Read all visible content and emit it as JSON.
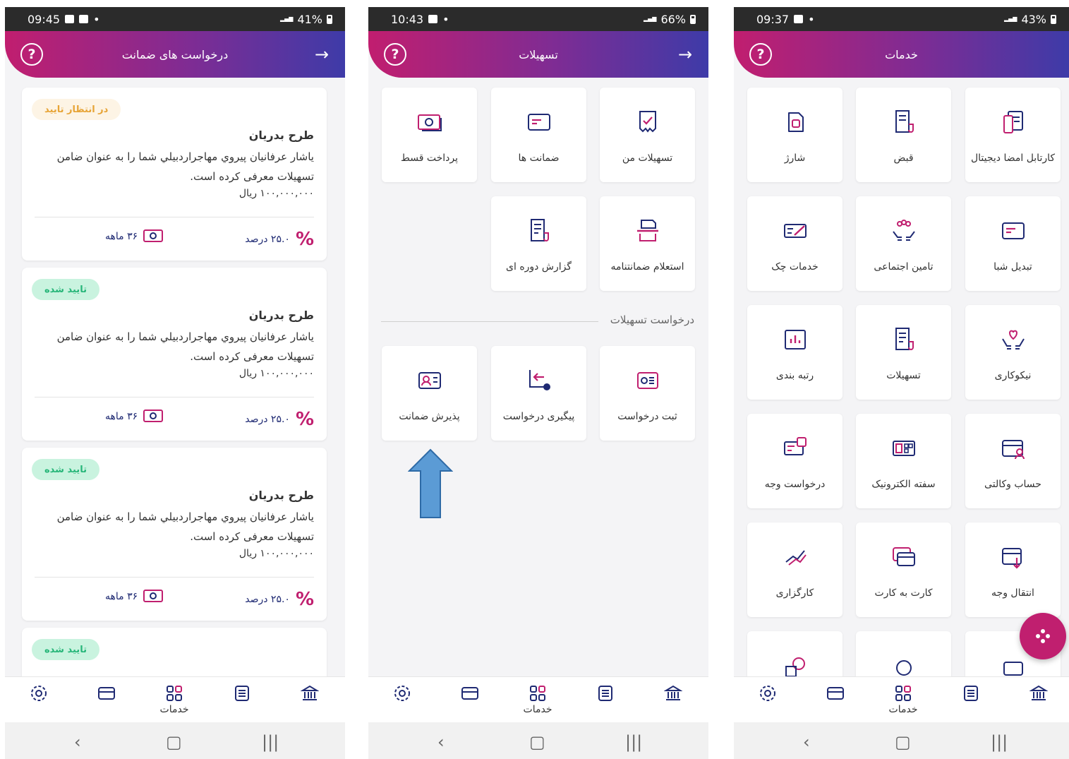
{
  "screens": [
    {
      "status": {
        "time": "09:45",
        "battery": "41%"
      },
      "header": {
        "title": "درخواست های ضمانت"
      },
      "cards": [
        {
          "status": "در انتظار تایید",
          "state": "pending",
          "title": "طرح بدریان",
          "description": "یاشار عرفانیان پیروي مهاجراردبيلي شما را به عنوان ضامن تسهیلات معرفی کرده است.",
          "amount": "۱۰۰,۰۰۰,۰۰۰ ریال",
          "rate": "۲۵.۰ درصد",
          "term": "۳۶ ماهه"
        },
        {
          "status": "تایید شده",
          "state": "approved",
          "title": "طرح بدریان",
          "description": "یاشار عرفانیان پیروي مهاجراردبيلي شما را به عنوان ضامن تسهیلات معرفی کرده است.",
          "amount": "۱۰۰,۰۰۰,۰۰۰ ریال",
          "rate": "۲۵.۰ درصد",
          "term": "۳۶ ماهه"
        },
        {
          "status": "تایید شده",
          "state": "approved",
          "title": "طرح بدریان",
          "description": "یاشار عرفانیان پیروي مهاجراردبيلي شما را به عنوان ضامن تسهیلات معرفی کرده است.",
          "amount": "۱۰۰,۰۰۰,۰۰۰ ریال",
          "rate": "۲۵.۰ درصد",
          "term": "۳۶ ماهه"
        },
        {
          "status": "تایید شده",
          "state": "approved"
        }
      ],
      "nav_label": "خدمات"
    },
    {
      "status": {
        "time": "10:43",
        "battery": "66%"
      },
      "header": {
        "title": "تسهیلات"
      },
      "tiles": [
        {
          "label": "تسهیلات من",
          "icon": "loan-check-icon"
        },
        {
          "label": "ضمانت ها",
          "icon": "card-icon"
        },
        {
          "label": "پرداخت قسط",
          "icon": "money-icon"
        },
        {
          "label": "استعلام ضمانتنامه",
          "icon": "printer-icon"
        },
        {
          "label": "گزارش دوره ای",
          "icon": "receipt-icon"
        }
      ],
      "section_title": "درخواست تسهیلات",
      "request_tiles": [
        {
          "label": "ثبت درخواست",
          "icon": "register-request-icon"
        },
        {
          "label": "پیگیری درخواست",
          "icon": "track-request-icon"
        },
        {
          "label": "پذیرش ضمانت",
          "icon": "accept-guarantee-icon"
        }
      ],
      "nav_label": "خدمات"
    },
    {
      "status": {
        "time": "09:37",
        "battery": "43%"
      },
      "header": {
        "title": "خدمات"
      },
      "tiles": [
        {
          "label": "کارتابل امضا دیجیتال",
          "icon": "digital-signature-icon"
        },
        {
          "label": "قبض",
          "icon": "bill-icon"
        },
        {
          "label": "شارژ",
          "icon": "sim-charge-icon"
        },
        {
          "label": "تبدیل شبا",
          "icon": "iban-card-icon"
        },
        {
          "label": "تامین اجتماعی",
          "icon": "social-security-icon"
        },
        {
          "label": "خدمات چک",
          "icon": "cheque-icon"
        },
        {
          "label": "نیکوکاری",
          "icon": "charity-icon"
        },
        {
          "label": "تسهیلات",
          "icon": "loan-icon"
        },
        {
          "label": "رتبه بندی",
          "icon": "rating-chart-icon"
        },
        {
          "label": "حساب وکالتی",
          "icon": "proxy-account-icon"
        },
        {
          "label": "سفته الکترونیک",
          "icon": "promissory-note-icon"
        },
        {
          "label": "درخواست وجه",
          "icon": "money-request-icon"
        },
        {
          "label": "انتقال وجه",
          "icon": "transfer-icon"
        },
        {
          "label": "کارت به کارت",
          "icon": "card-to-card-icon"
        },
        {
          "label": "کارگزاری",
          "icon": "brokerage-icon"
        }
      ],
      "nav_label": "خدمات"
    }
  ],
  "colors": {
    "brand": "#c01f6f",
    "navy": "#1f2a73",
    "pending": "#e7a436",
    "approved": "#27b679"
  }
}
